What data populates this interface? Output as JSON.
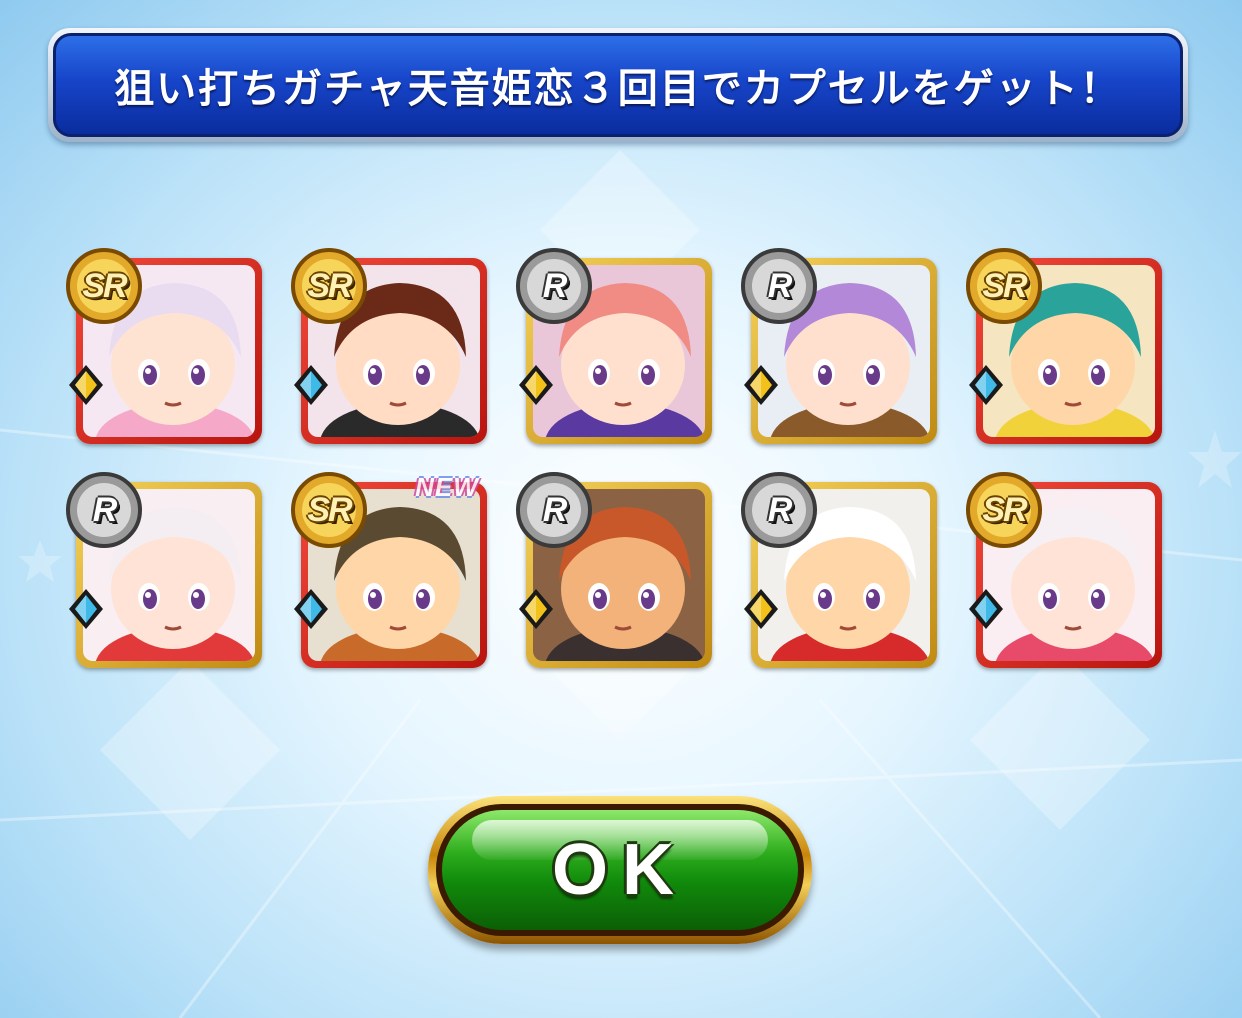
{
  "dialog": {
    "title": "狙い打ちガチャ天音姫恋３回目でカプセルをゲット！",
    "ok_label": "OK"
  },
  "colors": {
    "title_bar": "#1745c9",
    "ok_button": "#2fae1e",
    "sr_frame": "#d8261c",
    "r_frame": "#e0aa2a",
    "power_type": "#f2c21a",
    "skill_type": "#3fb9e8"
  },
  "cards": [
    {
      "rarity": "SR",
      "element": "power-type",
      "is_new": false,
      "new_label": ""
    },
    {
      "rarity": "SR",
      "element": "skill-type",
      "is_new": false,
      "new_label": ""
    },
    {
      "rarity": "R",
      "element": "power-type",
      "is_new": false,
      "new_label": ""
    },
    {
      "rarity": "R",
      "element": "power-type",
      "is_new": false,
      "new_label": ""
    },
    {
      "rarity": "SR",
      "element": "skill-type",
      "is_new": false,
      "new_label": ""
    },
    {
      "rarity": "R",
      "element": "skill-type",
      "is_new": false,
      "new_label": ""
    },
    {
      "rarity": "SR",
      "element": "skill-type",
      "is_new": true,
      "new_label": "NEW"
    },
    {
      "rarity": "R",
      "element": "power-type",
      "is_new": false,
      "new_label": ""
    },
    {
      "rarity": "R",
      "element": "power-type",
      "is_new": false,
      "new_label": ""
    },
    {
      "rarity": "SR",
      "element": "skill-type",
      "is_new": false,
      "new_label": ""
    }
  ]
}
